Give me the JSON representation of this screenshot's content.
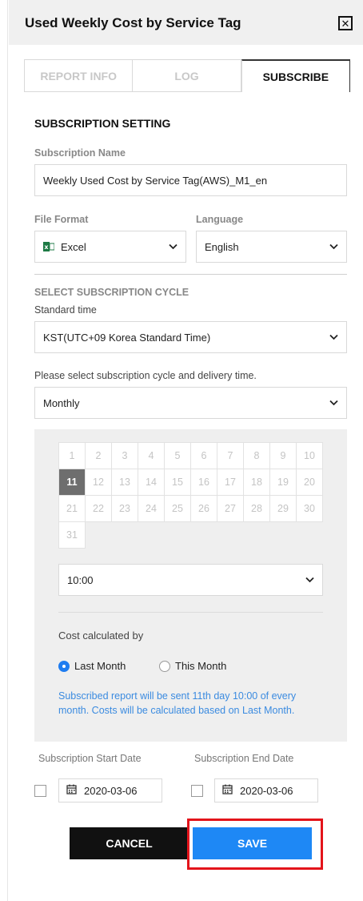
{
  "header": {
    "title": "Used Weekly Cost by Service Tag"
  },
  "tabs": [
    {
      "label": "REPORT INFO",
      "active": false
    },
    {
      "label": "LOG",
      "active": false
    },
    {
      "label": "SUBSCRIBE",
      "active": true
    }
  ],
  "form": {
    "section_title": "SUBSCRIPTION SETTING",
    "subscription_name_label": "Subscription Name",
    "subscription_name_value": "Weekly Used Cost by Service Tag(AWS)_M1_en",
    "file_format_label": "File Format",
    "file_format_value": "Excel",
    "language_label": "Language",
    "language_value": "English",
    "cycle_section_title": "SELECT SUBSCRIPTION CYCLE",
    "standard_time_label": "Standard time",
    "standard_time_value": "KST(UTC+09 Korea Standard Time)",
    "cycle_prompt": "Please select subscription cycle and delivery time.",
    "cycle_value": "Monthly"
  },
  "calendar": {
    "days": [
      "1",
      "2",
      "3",
      "4",
      "5",
      "6",
      "7",
      "8",
      "9",
      "10",
      "11",
      "12",
      "13",
      "14",
      "15",
      "16",
      "17",
      "18",
      "19",
      "20",
      "21",
      "22",
      "23",
      "24",
      "25",
      "26",
      "27",
      "28",
      "29",
      "30",
      "31"
    ],
    "selected": "11"
  },
  "panel": {
    "time_value": "10:00",
    "cost_label": "Cost calculated by",
    "radio_last_month": "Last Month",
    "radio_this_month": "This Month",
    "selected_option": "Last Month",
    "notice": "Subscribed report will be sent 11th day 10:00 of every month. Costs will be calculated based on Last Month."
  },
  "dates": {
    "start_label": "Subscription Start Date",
    "start_value": "2020-03-06",
    "end_label": "Subscription End Date",
    "end_value": "2020-03-06"
  },
  "buttons": {
    "cancel": "CANCEL",
    "save": "SAVE"
  },
  "colors": {
    "accent": "#1e88f5",
    "highlight": "#e3141b",
    "notice": "#3b8be0"
  }
}
